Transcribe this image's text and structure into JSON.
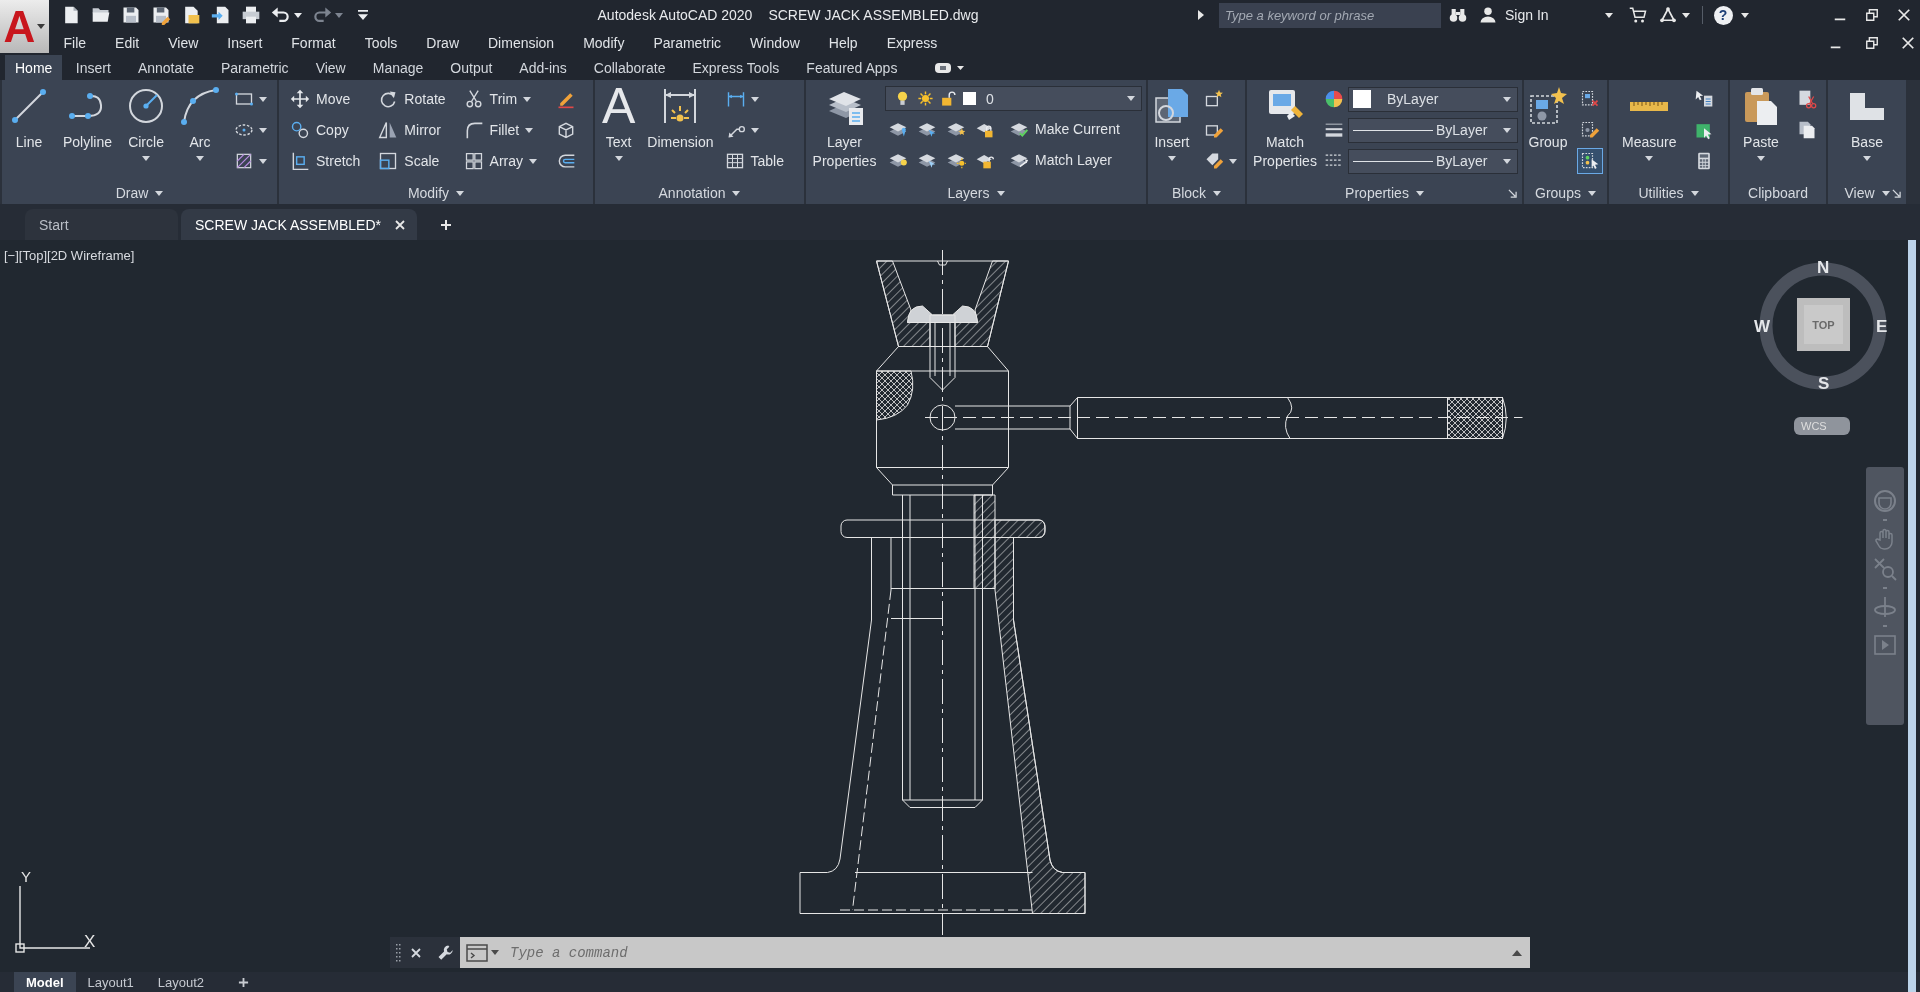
{
  "app_menu": {
    "logo": "A"
  },
  "title_bar": {
    "app_name": "Autodesk AutoCAD 2020",
    "file_name": "SCREW JACK ASSEMBLED.dwg",
    "search": {
      "placeholder": "Type a keyword or phrase"
    },
    "sign_in": "Sign In",
    "help": "?"
  },
  "menu_bar": [
    "File",
    "Edit",
    "View",
    "Insert",
    "Format",
    "Tools",
    "Draw",
    "Dimension",
    "Modify",
    "Parametric",
    "Window",
    "Help",
    "Express"
  ],
  "ribbon_tabs": [
    {
      "label": "Home",
      "selected": true
    },
    {
      "label": "Insert",
      "selected": false
    },
    {
      "label": "Annotate",
      "selected": false
    },
    {
      "label": "Parametric",
      "selected": false
    },
    {
      "label": "View",
      "selected": false
    },
    {
      "label": "Manage",
      "selected": false
    },
    {
      "label": "Output",
      "selected": false
    },
    {
      "label": "Add-ins",
      "selected": false
    },
    {
      "label": "Collaborate",
      "selected": false
    },
    {
      "label": "Express Tools",
      "selected": false
    },
    {
      "label": "Featured Apps",
      "selected": false
    }
  ],
  "ribbon_panels": [
    {
      "title": "Draw",
      "has_menu": true,
      "launcher": false,
      "columns": [
        {
          "kind": "large",
          "label": "Line",
          "dropdown": false
        },
        {
          "kind": "large",
          "label": "Polyline",
          "dropdown": false
        },
        {
          "kind": "large",
          "label": "Circle",
          "dropdown": true
        },
        {
          "kind": "large",
          "label": "Arc",
          "dropdown": true
        },
        {
          "kind": "stack",
          "items": [
            {
              "kind": "icon",
              "dropdown": true
            },
            {
              "kind": "icon",
              "dropdown": true
            },
            {
              "kind": "icon",
              "dropdown": true
            }
          ]
        }
      ]
    },
    {
      "title": "Modify",
      "has_menu": true,
      "launcher": false,
      "columns": [
        {
          "kind": "stack",
          "items": [
            {
              "kind": "small",
              "label": "Move",
              "dropdown": false
            },
            {
              "kind": "small",
              "label": "Copy",
              "dropdown": false
            },
            {
              "kind": "small",
              "label": "Stretch",
              "dropdown": false
            }
          ]
        },
        {
          "kind": "stack",
          "items": [
            {
              "kind": "small",
              "label": "Rotate",
              "dropdown": false
            },
            {
              "kind": "small",
              "label": "Mirror",
              "dropdown": false
            },
            {
              "kind": "small",
              "label": "Scale",
              "dropdown": false
            }
          ]
        },
        {
          "kind": "stack",
          "items": [
            {
              "kind": "small",
              "label": "Trim",
              "dropdown": true
            },
            {
              "kind": "small",
              "label": "Fillet",
              "dropdown": true
            },
            {
              "kind": "small",
              "label": "Array",
              "dropdown": true
            }
          ]
        },
        {
          "kind": "stack",
          "items": [
            {
              "kind": "icon",
              "dropdown": false
            },
            {
              "kind": "icon",
              "dropdown": false
            },
            {
              "kind": "icon",
              "dropdown": false
            }
          ]
        }
      ]
    },
    {
      "title": "Annotation",
      "has_menu": true,
      "launcher": false,
      "columns": [
        {
          "kind": "large",
          "label": "Text",
          "glyph": "A",
          "dropdown": true
        },
        {
          "kind": "large",
          "label": "Dimension",
          "dropdown": false
        },
        {
          "kind": "stack",
          "items": [
            {
              "kind": "icon",
              "dropdown": true
            },
            {
              "kind": "icon",
              "dropdown": true
            },
            {
              "kind": "small",
              "label": "Table",
              "dropdown": false
            }
          ]
        }
      ]
    },
    {
      "title": "Layers",
      "has_menu": true,
      "launcher": false,
      "columns": [
        {
          "kind": "large",
          "label": "Layer Properties",
          "dropdown": false
        },
        {
          "kind": "stack",
          "items": [
            {
              "kind": "layer_combo",
              "value": "0"
            },
            {
              "kind": "row",
              "items": [
                {
                  "kind": "icon",
                  "dropdown": false
                },
                {
                  "kind": "icon",
                  "dropdown": false
                },
                {
                  "kind": "icon",
                  "dropdown": false
                },
                {
                  "kind": "icon",
                  "dropdown": false
                },
                {
                  "kind": "small",
                  "label": "Make Current",
                  "dropdown": false
                }
              ]
            },
            {
              "kind": "row",
              "items": [
                {
                  "kind": "icon",
                  "dropdown": false
                },
                {
                  "kind": "icon",
                  "dropdown": false
                },
                {
                  "kind": "icon",
                  "dropdown": false
                },
                {
                  "kind": "icon",
                  "dropdown": false
                },
                {
                  "kind": "small",
                  "label": "Match Layer",
                  "dropdown": false
                }
              ]
            }
          ]
        }
      ]
    },
    {
      "title": "Block",
      "has_menu": true,
      "launcher": false,
      "columns": [
        {
          "kind": "large",
          "label": "Insert",
          "dropdown": true
        },
        {
          "kind": "stack",
          "items": [
            {
              "kind": "icon",
              "dropdown": false
            },
            {
              "kind": "icon",
              "dropdown": false
            },
            {
              "kind": "icon",
              "dropdown": true
            }
          ]
        }
      ]
    },
    {
      "title": "Properties",
      "has_menu": true,
      "launcher": true,
      "columns": [
        {
          "kind": "large",
          "label": "Match Properties",
          "dropdown": false
        },
        {
          "kind": "stack",
          "items": [
            {
              "kind": "color_combo",
              "value": "ByLayer"
            },
            {
              "kind": "line_combo",
              "value": "ByLayer"
            },
            {
              "kind": "line_combo",
              "value": "ByLayer"
            }
          ]
        }
      ]
    },
    {
      "title": "Groups",
      "has_menu": true,
      "launcher": false,
      "columns": [
        {
          "kind": "large",
          "label": "Group",
          "dropdown": false
        },
        {
          "kind": "stack",
          "items": [
            {
              "kind": "icon",
              "dropdown": false,
              "on": false
            },
            {
              "kind": "icon",
              "dropdown": false,
              "on": false
            },
            {
              "kind": "icon",
              "dropdown": false,
              "on": true
            }
          ]
        }
      ]
    },
    {
      "title": "Utilities",
      "has_menu": true,
      "launcher": false,
      "columns": [
        {
          "kind": "large",
          "label": "Measure",
          "dropdown": true
        },
        {
          "kind": "stack",
          "items": [
            {
              "kind": "icon",
              "dropdown": false
            },
            {
              "kind": "icon",
              "dropdown": false
            },
            {
              "kind": "icon",
              "dropdown": false
            }
          ]
        }
      ]
    },
    {
      "title": "Clipboard",
      "has_menu": false,
      "launcher": false,
      "columns": [
        {
          "kind": "large",
          "label": "Paste",
          "dropdown": true
        },
        {
          "kind": "stack",
          "items": [
            {
              "kind": "icon",
              "dropdown": false
            },
            {
              "kind": "icon",
              "dropdown": false
            }
          ]
        }
      ]
    },
    {
      "title": "View",
      "has_menu": true,
      "launcher": true,
      "columns": [
        {
          "kind": "large",
          "label": "Base",
          "dropdown": true
        }
      ]
    }
  ],
  "document_tabs": [
    {
      "label": "Start",
      "selected": false,
      "closable": false
    },
    {
      "label": "SCREW JACK ASSEMBLED*",
      "selected": true,
      "closable": true
    }
  ],
  "viewport": {
    "controls": [
      "[−]",
      "[Top]",
      "[2D Wireframe]"
    ],
    "viewcube": {
      "north": "N",
      "west": "W",
      "east": "E",
      "south": "S",
      "face": "TOP",
      "coordinate_system": "WCS"
    },
    "ucs_icon": {
      "y": "Y",
      "x": "X"
    }
  },
  "command_line": {
    "placeholder": "Type a command"
  },
  "layout_tabs": [
    {
      "label": "Model",
      "selected": true
    },
    {
      "label": "Layout1",
      "selected": false
    },
    {
      "label": "Layout2",
      "selected": false
    }
  ]
}
